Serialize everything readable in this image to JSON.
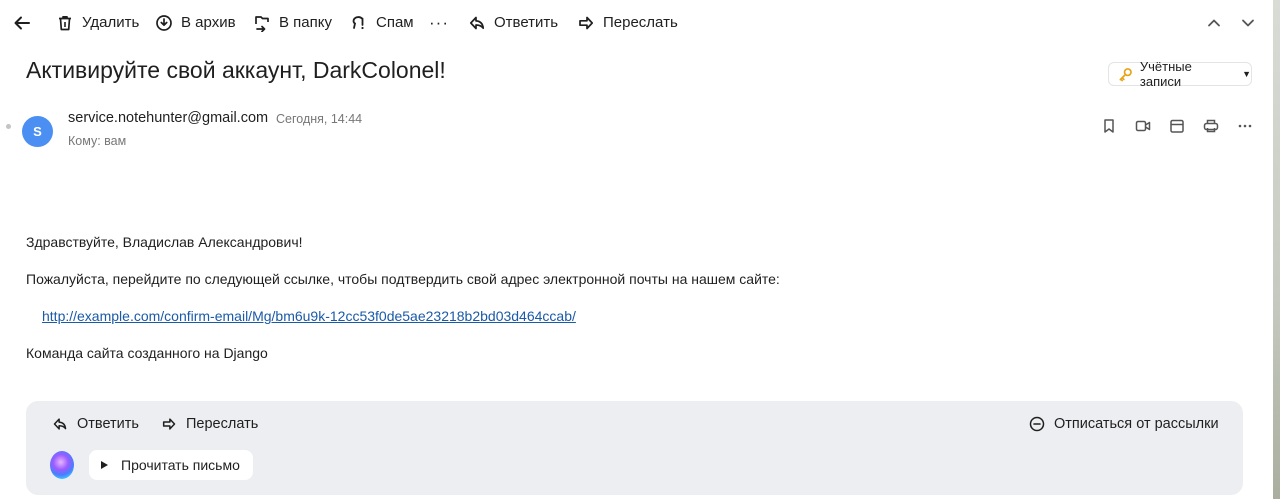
{
  "toolbar": {
    "delete_label": "Удалить",
    "archive_label": "В архив",
    "folder_label": "В папку",
    "spam_label": "Спам",
    "more_label": "···",
    "reply_label": "Ответить",
    "forward_label": "Переслать"
  },
  "message": {
    "subject": "Активируйте свой аккаунт, DarkColonel!",
    "accounts_label": "Учётные записи",
    "sender_avatar_letter": "S",
    "sender_email": "service.notehunter@gmail.com",
    "date": "Сегодня, 14:44",
    "to_line": "Кому: вам",
    "greeting": "Здравствуйте, Владислав Александрович!",
    "instruction": "Пожалуйста, перейдите по следующей ссылке, чтобы подтвердить свой адрес электронной почты на нашем сайте:",
    "confirm_link": "http://example.com/confirm-email/Mg/bm6u9k-12cc53f0de5ae23218b2bd03d464ccab/",
    "signature": "Команда сайта созданного на Django"
  },
  "bottom_panel": {
    "reply_label": "Ответить",
    "forward_label": "Переслать",
    "unsubscribe_label": "Отписаться от рассылки",
    "read_aloud_label": "Прочитать письмо"
  },
  "colors": {
    "avatar": "#4b8ff2",
    "link": "#1a5aa8",
    "panel_bg": "#eceef1",
    "key_icon": "#e8a317"
  }
}
